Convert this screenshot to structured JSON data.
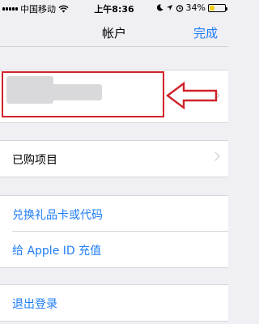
{
  "status_bar": {
    "carrier": "中国移动",
    "time": "上午8:36",
    "battery_percent": "34%",
    "battery_level": 0.34,
    "battery_color": "#f5cf20"
  },
  "nav": {
    "title": "帐户",
    "done_label": "完成"
  },
  "cells": {
    "purchased": "已购项目",
    "redeem": "兑换礼品卡或代码",
    "add_funds": "给 Apple ID 充值",
    "sign_out": "退出登录"
  },
  "colors": {
    "accent": "#1f7cf7",
    "highlight": "#d0222a",
    "background": "#efeff4"
  },
  "icons": {
    "signal": "signal-bars-icon",
    "wifi": "wifi-icon",
    "moon": "moon-icon",
    "location": "location-arrow-icon",
    "alarm": "alarm-icon",
    "battery": "battery-icon",
    "chevron": "chevron-right-icon",
    "arrow": "left-arrow-icon"
  }
}
